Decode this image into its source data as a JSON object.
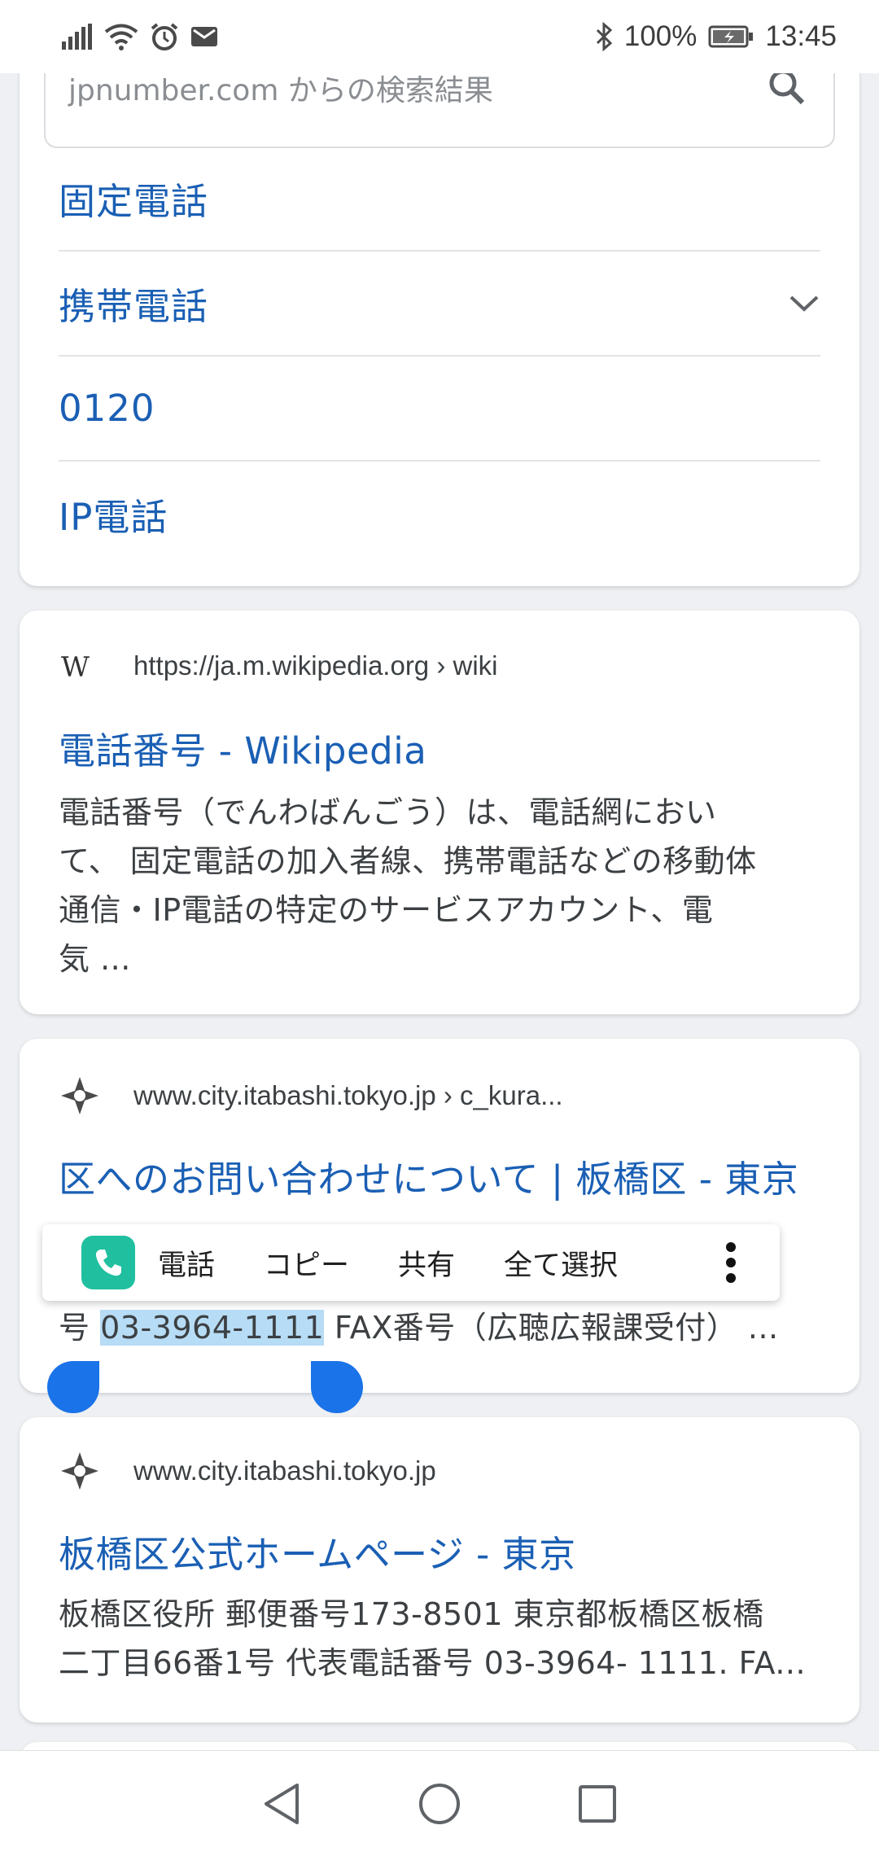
{
  "status_bar": {
    "battery": "100%",
    "time": "13:45"
  },
  "search": {
    "query": "jpnumber.com からの検索結果"
  },
  "links": [
    {
      "label": "固定電話"
    },
    {
      "label": "携帯電話"
    },
    {
      "label": "0120"
    },
    {
      "label": "IP電話"
    }
  ],
  "results": [
    {
      "url": "https://ja.m.wikipedia.org › wiki",
      "title": "電話番号 - Wikipedia",
      "snippet_lines": [
        "電話番号（でんわばんごう）は、電話網におい",
        "て、 固定電話の加入者線、携帯電話などの移動体",
        "通信・IP電話の特定のサービスアカウント、電",
        "気 ..."
      ]
    },
    {
      "url": "www.city.itabashi.tokyo.jp › c_kura...",
      "title": "区へのお問い合わせについて | 板橋区 - 東京",
      "snippet_prefix": "号",
      "snippet_selected": "03-3964-1111",
      "snippet_suffix": "FAX番号（広聴広報課受付） ..."
    },
    {
      "url": "www.city.itabashi.tokyo.jp",
      "title": "板橋区公式ホームページ - 東京",
      "snippet_lines": [
        "板橋区役所 郵便番号173-8501 東京都板橋区板橋",
        "二丁目66番1号 代表電話番号 03-3964- 1111. FA..."
      ]
    }
  ],
  "context_menu": {
    "items": [
      "電話",
      "コピー",
      "共有",
      "全て選択"
    ]
  },
  "colors": {
    "link": "#1a5fb4",
    "selection": "#b7dcf5",
    "handle": "#1a73e8",
    "phone_app": "#1fbf9f"
  }
}
